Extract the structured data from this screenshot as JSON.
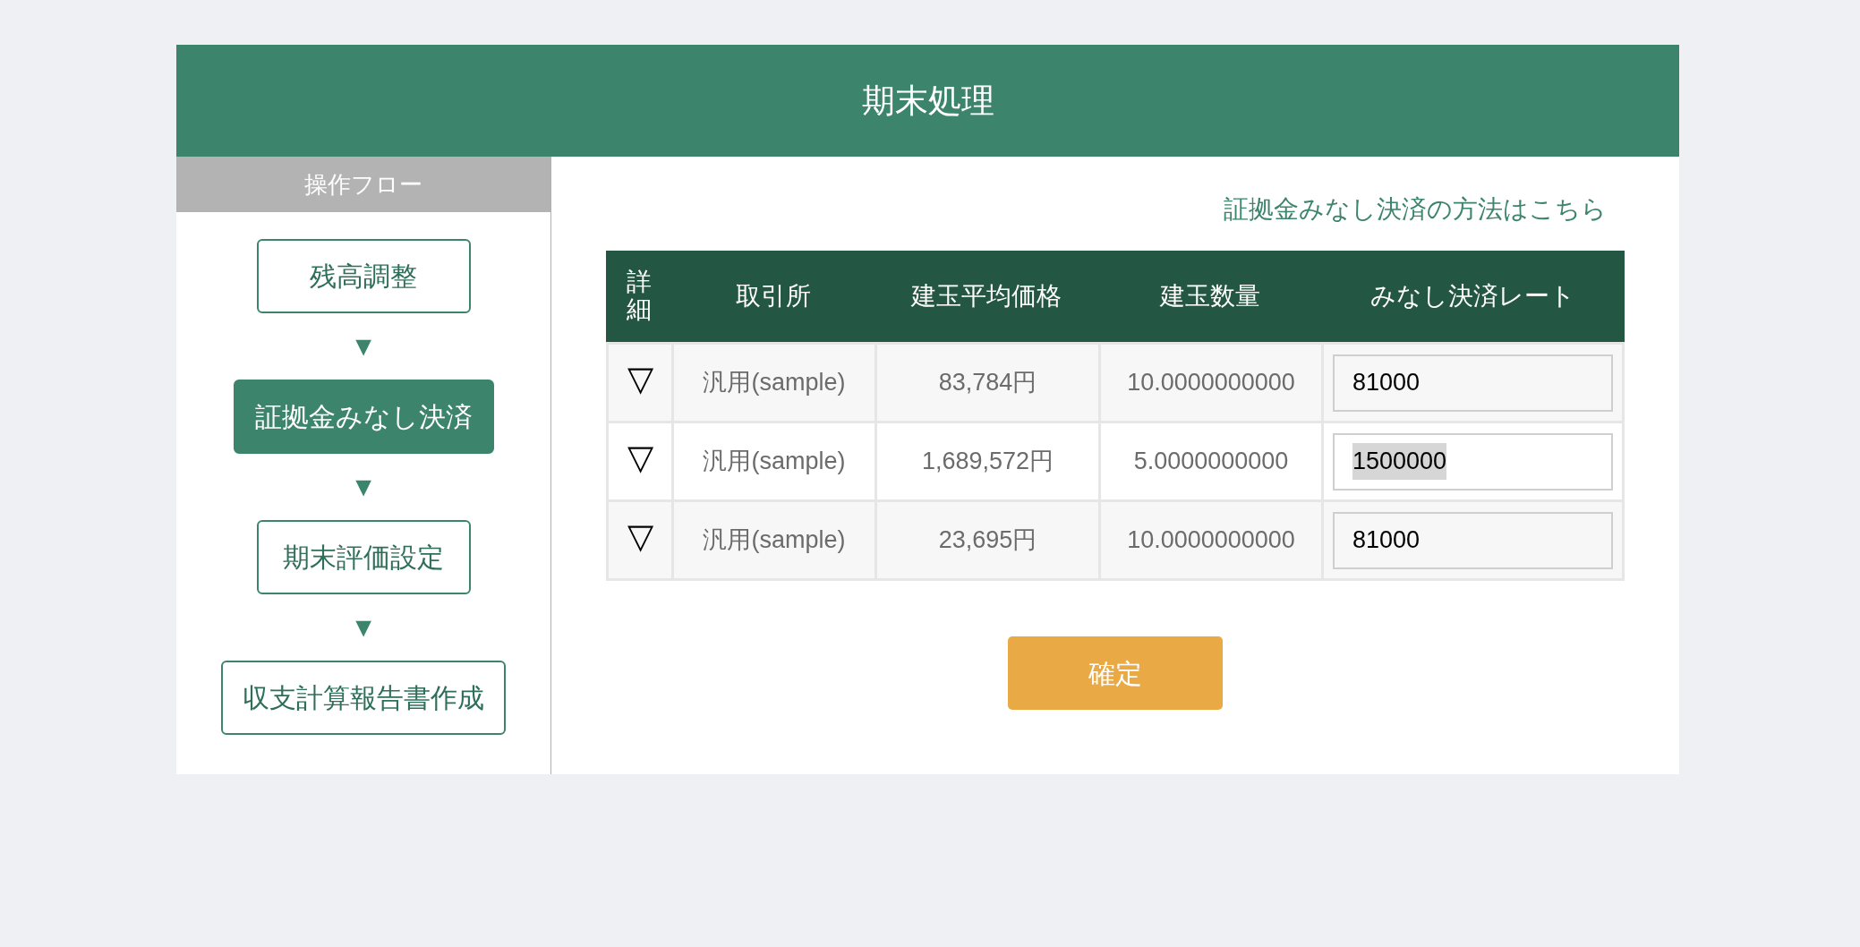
{
  "header": {
    "title": "期末処理"
  },
  "sidebar": {
    "title": "操作フロー",
    "arrow": "▼",
    "steps": [
      {
        "label": "残高調整",
        "selected": false
      },
      {
        "label": "証拠金みなし決済",
        "selected": true
      },
      {
        "label": "期末評価設定",
        "selected": false
      },
      {
        "label": "収支計算報告書作成",
        "selected": false
      }
    ]
  },
  "help_link": "証拠金みなし決済の方法はこちら",
  "table": {
    "columns": [
      "詳細",
      "取引所",
      "建玉平均価格",
      "建玉数量",
      "みなし決済レート"
    ],
    "rows": [
      {
        "detail": "▽",
        "exchange": "汎用(sample)",
        "avg_price": "83,784円",
        "quantity": "10.0000000000",
        "rate": "81000",
        "rate_selected": false
      },
      {
        "detail": "▽",
        "exchange": "汎用(sample)",
        "avg_price": "1,689,572円",
        "quantity": "5.0000000000",
        "rate": "1500000",
        "rate_selected": true
      },
      {
        "detail": "▽",
        "exchange": "汎用(sample)",
        "avg_price": "23,695円",
        "quantity": "10.0000000000",
        "rate": "81000",
        "rate_selected": false
      }
    ]
  },
  "confirm_button": "確定"
}
